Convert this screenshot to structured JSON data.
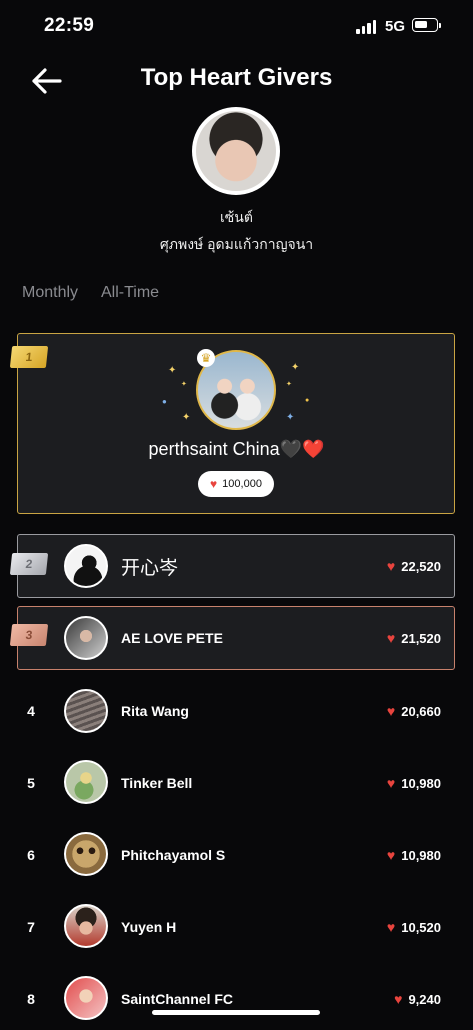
{
  "status": {
    "time": "22:59",
    "network": "5G"
  },
  "header": {
    "title": "Top Heart Givers"
  },
  "profile": {
    "name": "เซ้นต์",
    "full_name": "ศุภพงษ์ อุดมแก้วกาญจนา"
  },
  "tabs": [
    {
      "label": "Monthly"
    },
    {
      "label": "All-Time"
    }
  ],
  "top_giver": {
    "rank": "1",
    "name": "perthsaint China🖤❤️",
    "hearts": "100,000"
  },
  "givers": [
    {
      "rank": "2",
      "name": "开心岑",
      "hearts": "22,520"
    },
    {
      "rank": "3",
      "name": "AE LOVE PETE",
      "hearts": "21,520"
    },
    {
      "rank": "4",
      "name": "Rita Wang",
      "hearts": "20,660"
    },
    {
      "rank": "5",
      "name": "Tinker  Bell",
      "hearts": "10,980"
    },
    {
      "rank": "6",
      "name": "Phitchayamol S",
      "hearts": "10,980"
    },
    {
      "rank": "7",
      "name": "Yuyen H",
      "hearts": "10,520"
    },
    {
      "rank": "8",
      "name": "SaintChannel FC",
      "hearts": "9,240"
    }
  ],
  "icons": {
    "back": "back-arrow-icon",
    "heart": "heart-icon",
    "crown": "crown-icon"
  },
  "colors": {
    "gold": "#c9a443",
    "silver": "#9a9ba0",
    "bronze": "#c7816c",
    "heart": "#e8443e"
  }
}
